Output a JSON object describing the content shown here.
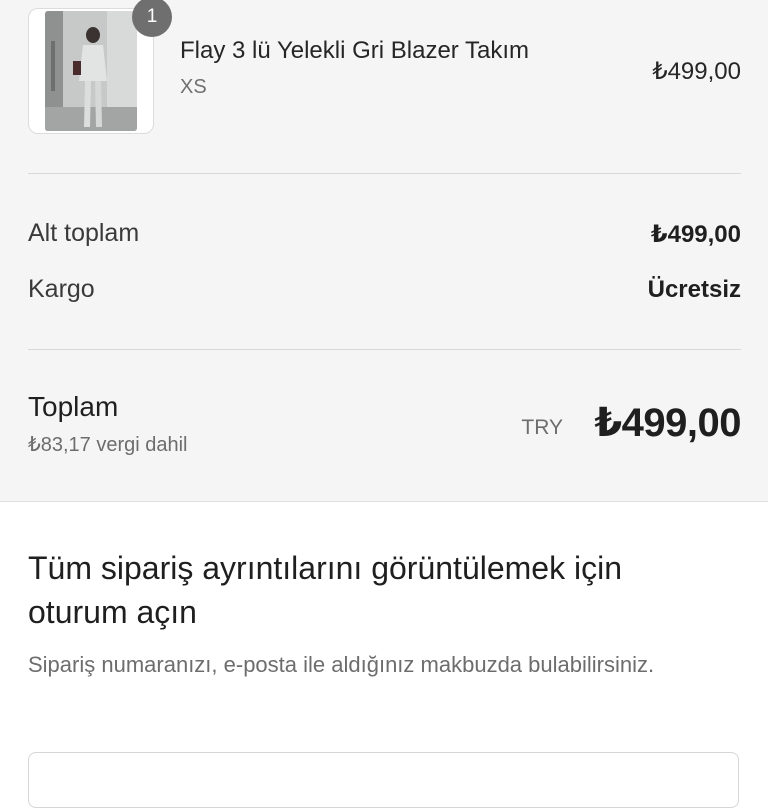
{
  "product": {
    "quantity": "1",
    "title": "Flay 3 lü Yelekli Gri Blazer Takım",
    "variant": "XS",
    "price": "₺499,00",
    "image_icon": "product-photo-gray-blazer-suit"
  },
  "summary": {
    "subtotal_label": "Alt toplam",
    "subtotal_value": "₺499,00",
    "shipping_label": "Kargo",
    "shipping_value": "Ücretsiz",
    "total_label": "Toplam",
    "tax_note": "₺83,17 vergi dahil",
    "currency_code": "TRY",
    "total_value": "₺499,00"
  },
  "login": {
    "title": "Tüm sipariş ayrıntılarını görüntülemek için oturum açın",
    "subtitle": "Sipariş numaranızı, e-posta ile aldığınız makbuzda bulabilirsiniz."
  },
  "colors": {
    "summary_background": "#f5f5f5",
    "badge": "#6f6f6f",
    "divider": "#d9d9d9"
  }
}
